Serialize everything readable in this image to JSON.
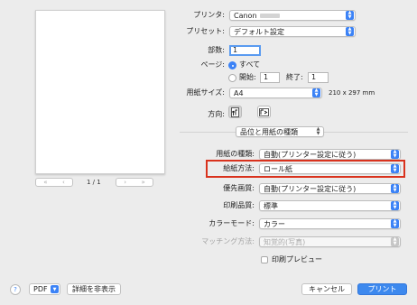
{
  "printer": {
    "label": "プリンタ:",
    "value": "Canon"
  },
  "preset": {
    "label": "プリセット:",
    "value": "デフォルト設定"
  },
  "copies": {
    "label": "部数:",
    "value": "1"
  },
  "pages": {
    "label": "ページ:",
    "all_label": "すべて",
    "from_label": "開始:",
    "from_value": "1",
    "to_label": "終了:",
    "to_value": "1",
    "selected": "all"
  },
  "paper_size": {
    "label": "用紙サイズ:",
    "value": "A4",
    "dimensions": "210 x 297 mm"
  },
  "orientation": {
    "label": "方向:",
    "selected": "portrait"
  },
  "section": {
    "value": "品位と用紙の種類"
  },
  "media_type": {
    "label": "用紙の種類:",
    "value": "自動(プリンター設定に従う)"
  },
  "paper_source": {
    "label": "給紙方法:",
    "value": "ロール紙"
  },
  "priority": {
    "label": "優先画質:",
    "value": "自動(プリンター設定に従う)"
  },
  "print_quality": {
    "label": "印刷品質:",
    "value": "標準"
  },
  "color_mode": {
    "label": "カラーモード:",
    "value": "カラー"
  },
  "matching": {
    "label": "マッチング方法:",
    "value": "知覚的(写真)"
  },
  "print_preview": {
    "label": "印刷プレビュー",
    "checked": false
  },
  "page_indicator": "1 / 1",
  "footer": {
    "help": "?",
    "pdf_label": "PDF",
    "hide_details_label": "詳細を非表示",
    "cancel_label": "キャンセル",
    "print_label": "プリント"
  },
  "colors": {
    "accent": "#3b82f6",
    "highlight_border": "#d9321d"
  }
}
